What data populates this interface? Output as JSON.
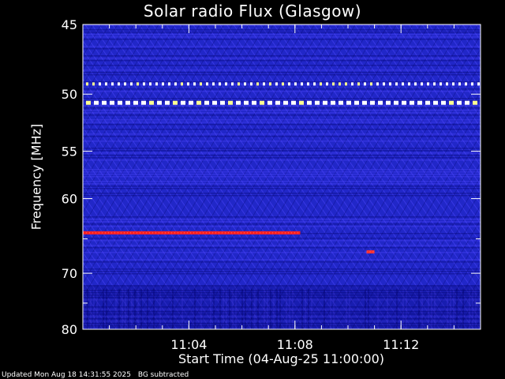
{
  "chart_data": {
    "type": "heatmap",
    "title": "Solar radio Flux (Glasgow)",
    "xlabel": "Start Time (04-Aug-25 11:00:00)",
    "ylabel": "Frequency [MHz]",
    "xlim_minutes": [
      0,
      15
    ],
    "ylim_mhz": [
      45,
      80
    ],
    "y_reversed": true,
    "y_ticks": [
      {
        "value": 45,
        "label": "45"
      },
      {
        "value": 50,
        "label": "50"
      },
      {
        "value": 55,
        "label": "55"
      },
      {
        "value": 60,
        "label": "60"
      },
      {
        "value": 70,
        "label": "70"
      },
      {
        "value": 80,
        "label": "80"
      }
    ],
    "y_minor_ticks": [
      65,
      75
    ],
    "x_ticks": [
      {
        "value": 4,
        "label": "11:04"
      },
      {
        "value": 8,
        "label": "11:08"
      },
      {
        "value": 12,
        "label": "11:12"
      }
    ],
    "x_minor_tick_step": 1,
    "grid": false,
    "colormap": [
      "#000066",
      "#1f28e0",
      "#5048ff",
      "#c01010",
      "#ff2020",
      "#ffff90",
      "#ffffff"
    ],
    "background_color": "#2127c8",
    "interference_lines": [
      {
        "freq_mhz": 49.2,
        "t_start": 0,
        "t_end": 15,
        "style": "dashed",
        "color": "#ffffff"
      },
      {
        "freq_mhz": 50.7,
        "t_start": 0,
        "t_end": 15,
        "style": "dashed",
        "color": "#ffffff"
      },
      {
        "freq_mhz": 64.2,
        "t_start": 0,
        "t_end": 8.2,
        "style": "solid",
        "color": "#ff2020"
      },
      {
        "freq_mhz": 66.8,
        "t_start": 10.7,
        "t_end": 11.0,
        "style": "solid",
        "color": "#ff3030"
      }
    ]
  },
  "footer": {
    "updated": "Updated Mon Aug 18 14:31:55 2025",
    "bg_note": "BG subtracted"
  }
}
